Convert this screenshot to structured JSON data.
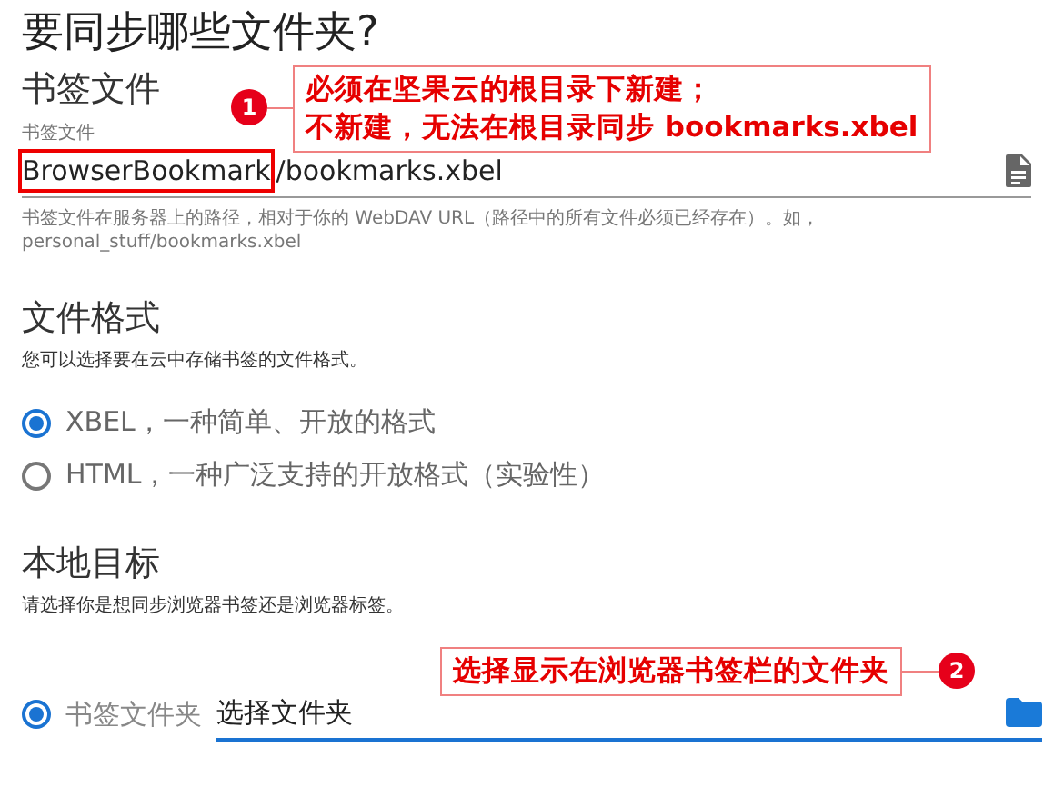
{
  "title": "要同步哪些文件夹?",
  "bookmark_file": {
    "heading": "书签文件",
    "label": "书签文件",
    "value_segments": [
      {
        "text": "BrowserBookmark",
        "highlighted": true
      },
      {
        "text": "/bookmarks.xbel",
        "highlighted": false
      }
    ],
    "help": "书签文件在服务器上的路径，相对于你的 WebDAV URL（路径中的所有文件必须已经存在）。如，personal_stuff/bookmarks.xbel"
  },
  "file_format": {
    "heading": "文件格式",
    "description": "您可以选择要在云中存储书签的文件格式。",
    "options": [
      {
        "label": "XBEL，一种简单、开放的格式",
        "selected": true
      },
      {
        "label": "HTML，一种广泛支持的开放格式（实验性）",
        "selected": false
      }
    ]
  },
  "local_target": {
    "heading": "本地目标",
    "description": "请选择你是想同步浏览器书签还是浏览器标签。",
    "options": [
      {
        "label": "书签文件夹",
        "selected": true,
        "field_value": "选择文件夹"
      }
    ]
  },
  "annotations": [
    {
      "number": "1",
      "lines": [
        "必须在坚果云的根目录下新建；",
        "不新建，无法在根目录同步 bookmarks.xbel"
      ]
    },
    {
      "number": "2",
      "lines": [
        "选择显示在浏览器书签栏的文件夹"
      ]
    }
  ]
}
